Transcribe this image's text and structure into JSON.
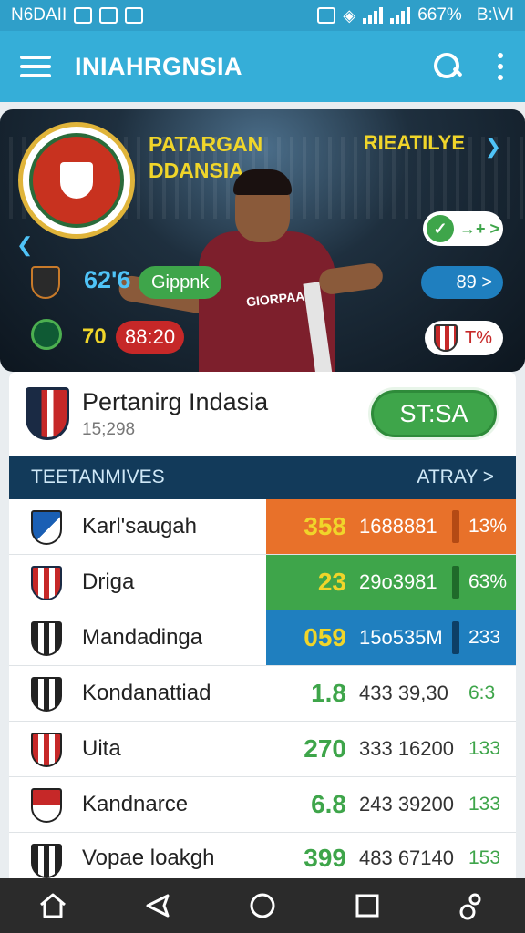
{
  "status_bar": {
    "carrier": "N6DAII",
    "battery": "667%",
    "time": "B:\\VI"
  },
  "app_bar": {
    "title": "INIAHRGNSIA"
  },
  "hero": {
    "title_line1": "PATARGAN",
    "title_line2": "DDANSIA",
    "right_label": "RIEATILYE",
    "stat_a": "62'6",
    "pill_green": "Gippnk",
    "stat_b": "70",
    "pill_red": "88:20",
    "toggle_arrows": "→+ >",
    "pill_blue": "89 >",
    "pill_white": "T%",
    "shirt_text": "GIORPAA"
  },
  "league": {
    "name": "Pertanirg Indasia",
    "sub": "15;298",
    "status": "ST:SA"
  },
  "table": {
    "header_left": "TEETANMIVES",
    "header_right": "ATRAY >",
    "rows": [
      {
        "name": "Karl'saugah",
        "v1": "358",
        "v2": "1688881",
        "v3": "13%"
      },
      {
        "name": "Driga",
        "v1": "23",
        "v2": "29o3981",
        "v3": "63%"
      },
      {
        "name": "Mandadinga",
        "v1": "059",
        "v2": "15o535M",
        "v3": "233"
      },
      {
        "name": "Kondanattiad",
        "v1": "1.8",
        "v2": "433 39,30",
        "v3": "6:3"
      },
      {
        "name": "Uita",
        "v1": "270",
        "v2": "333 16200",
        "v3": "133"
      },
      {
        "name": "Kandnarce",
        "v1": "6.8",
        "v2": "243 39200",
        "v3": "133"
      },
      {
        "name": "Vopae loakgh",
        "v1": "399",
        "v2": "483 67140",
        "v3": "153"
      }
    ]
  },
  "colors": {
    "primary": "#35aed8",
    "row_orange": "#e8712a",
    "row_green": "#3ea54a",
    "row_blue": "#1f7fbf",
    "accent_yellow": "#f0d52a"
  }
}
